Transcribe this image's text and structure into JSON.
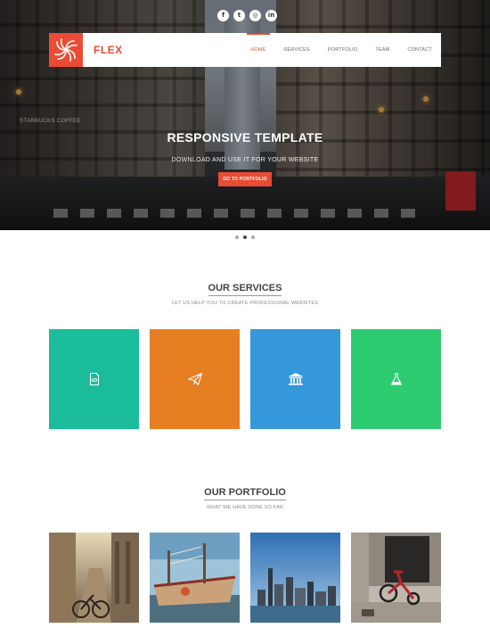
{
  "social": [
    {
      "icon": "facebook-icon",
      "glyph": "f"
    },
    {
      "icon": "twitter-icon",
      "glyph": "t"
    },
    {
      "icon": "dribbble-icon",
      "glyph": "◎"
    },
    {
      "icon": "linkedin-icon",
      "glyph": "in"
    }
  ],
  "brand": {
    "name": "FLEX",
    "color": "#e94b35"
  },
  "nav": {
    "items": [
      "HOME",
      "SERVICES",
      "PORTFOLIO",
      "TEAM",
      "CONTACT"
    ],
    "active": "HOME"
  },
  "hero": {
    "title": "RESPONSIVE TEMPLATE",
    "subtitle": "DOWNLOAD AND USE IT FOR YOUR WEBSITE",
    "button": "GO TO PORTFOLIO",
    "slides": 3,
    "active_slide": 2,
    "signage": "STARBUCKS COFFEE"
  },
  "services": {
    "title": "OUR SERVICES",
    "subtitle": "LET US HELP YOU TO CREATE PROFESSIONAL WEBSITES",
    "tiles": [
      {
        "icon": "code-file-icon",
        "color": "#1abc9c"
      },
      {
        "icon": "paper-plane-icon",
        "color": "#e67e22"
      },
      {
        "icon": "bank-icon",
        "color": "#3498db"
      },
      {
        "icon": "flask-icon",
        "color": "#2ecc71"
      }
    ]
  },
  "portfolio": {
    "title": "OUR PORTFOLIO",
    "subtitle": "WHAT WE HAVE DONE SO FAR",
    "items": [
      {
        "subject": "old-street-bicycle"
      },
      {
        "subject": "harbor-boats"
      },
      {
        "subject": "city-skyline"
      },
      {
        "subject": "red-tricycle"
      }
    ]
  }
}
